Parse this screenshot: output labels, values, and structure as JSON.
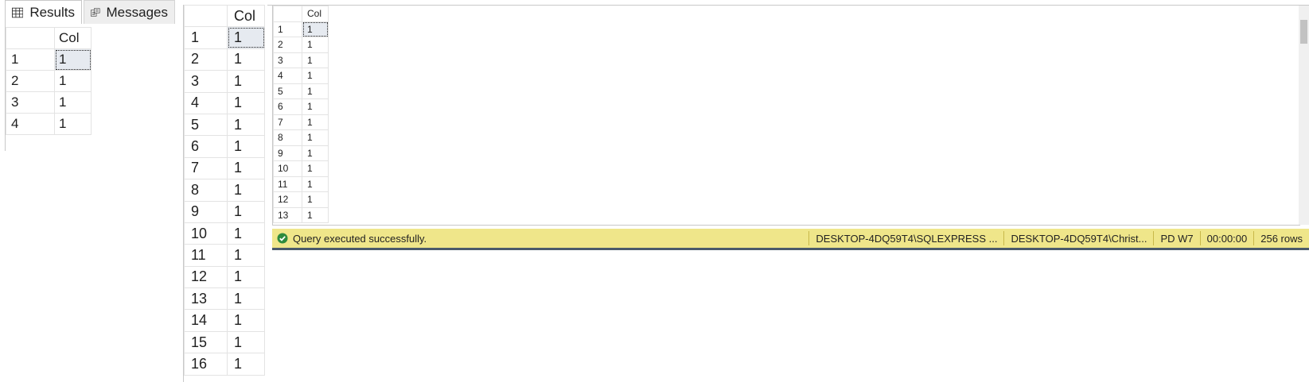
{
  "panel1": {
    "tabs": [
      {
        "label": "Results",
        "icon": "grid-icon"
      },
      {
        "label": "Messages",
        "icon": "messages-icon"
      }
    ],
    "column_header": "Col",
    "rows": [
      {
        "num": "1",
        "val": "1"
      },
      {
        "num": "2",
        "val": "1"
      },
      {
        "num": "3",
        "val": "1"
      },
      {
        "num": "4",
        "val": "1"
      }
    ]
  },
  "panel2": {
    "column_header": "Col",
    "rows": [
      {
        "num": "1",
        "val": "1"
      },
      {
        "num": "2",
        "val": "1"
      },
      {
        "num": "3",
        "val": "1"
      },
      {
        "num": "4",
        "val": "1"
      },
      {
        "num": "5",
        "val": "1"
      },
      {
        "num": "6",
        "val": "1"
      },
      {
        "num": "7",
        "val": "1"
      },
      {
        "num": "8",
        "val": "1"
      },
      {
        "num": "9",
        "val": "1"
      },
      {
        "num": "10",
        "val": "1"
      },
      {
        "num": "11",
        "val": "1"
      },
      {
        "num": "12",
        "val": "1"
      },
      {
        "num": "13",
        "val": "1"
      },
      {
        "num": "14",
        "val": "1"
      },
      {
        "num": "15",
        "val": "1"
      },
      {
        "num": "16",
        "val": "1"
      }
    ]
  },
  "panel3": {
    "column_header": "Col",
    "rows": [
      {
        "num": "1",
        "val": "1"
      },
      {
        "num": "2",
        "val": "1"
      },
      {
        "num": "3",
        "val": "1"
      },
      {
        "num": "4",
        "val": "1"
      },
      {
        "num": "5",
        "val": "1"
      },
      {
        "num": "6",
        "val": "1"
      },
      {
        "num": "7",
        "val": "1"
      },
      {
        "num": "8",
        "val": "1"
      },
      {
        "num": "9",
        "val": "1"
      },
      {
        "num": "10",
        "val": "1"
      },
      {
        "num": "11",
        "val": "1"
      },
      {
        "num": "12",
        "val": "1"
      },
      {
        "num": "13",
        "val": "1"
      }
    ],
    "status": {
      "message": "Query executed successfully.",
      "server": "DESKTOP-4DQ59T4\\SQLEXPRESS ...",
      "user": "DESKTOP-4DQ59T4\\Christ...",
      "database": "PD W7",
      "elapsed": "00:00:00",
      "row_count": "256 rows",
      "color": "#efe68a"
    }
  }
}
